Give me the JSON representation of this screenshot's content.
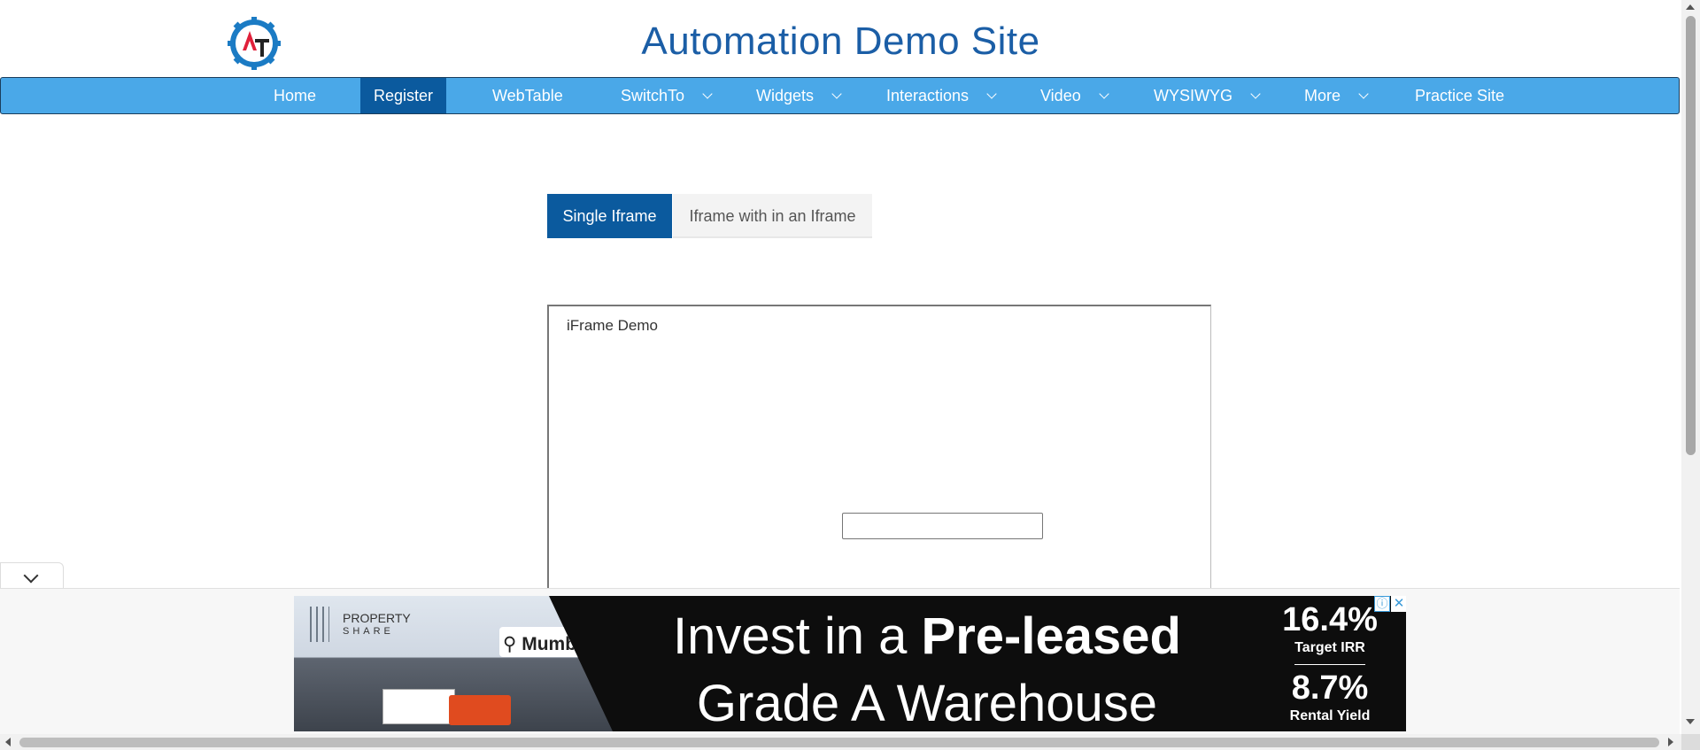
{
  "header": {
    "logo_icon": "gear-logo-icon",
    "title": "Automation Demo Site"
  },
  "nav": {
    "items": [
      {
        "label": "Home",
        "dropdown": false,
        "active": false
      },
      {
        "label": "Register",
        "dropdown": false,
        "active": true
      },
      {
        "label": "WebTable",
        "dropdown": false,
        "active": false
      },
      {
        "label": "SwitchTo",
        "dropdown": true,
        "active": false
      },
      {
        "label": "Widgets",
        "dropdown": true,
        "active": false
      },
      {
        "label": "Interactions",
        "dropdown": true,
        "active": false
      },
      {
        "label": "Video",
        "dropdown": true,
        "active": false
      },
      {
        "label": "WYSIWYG",
        "dropdown": true,
        "active": false
      },
      {
        "label": "More",
        "dropdown": true,
        "active": false
      },
      {
        "label": "Practice Site",
        "dropdown": false,
        "active": false
      }
    ],
    "bar_color": "#4aa8e8",
    "active_color": "#0b5a9e"
  },
  "tabs": {
    "single": "Single Iframe",
    "nested": "Iframe with in an Iframe"
  },
  "iframe": {
    "title": "iFrame Demo",
    "input_value": ""
  },
  "ad": {
    "brand_line1": "PROPERTY",
    "brand_line2": "SHARE",
    "city": "Mumbai",
    "headline_plain": "Invest in a ",
    "headline_bold": "Pre-leased",
    "headline_line2": "Grade A Warehouse",
    "stat1_value": "16.4%",
    "stat1_label": "Target IRR",
    "stat2_value": "8.7%",
    "stat2_label": "Rental Yield",
    "info_glyph": "ⓘ",
    "close_glyph": "✕"
  }
}
